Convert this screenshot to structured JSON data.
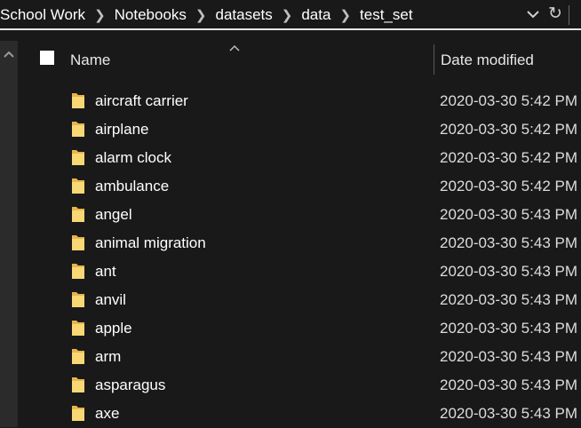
{
  "breadcrumb": [
    "School Work",
    "Notebooks",
    "datasets",
    "data",
    "test_set"
  ],
  "address_bar": {
    "dropdown_icon": "chevron-down-icon",
    "refresh_icon": "refresh-icon",
    "refresh_glyph": "↻"
  },
  "columns": {
    "name_label": "Name",
    "date_label": "Date modified",
    "sort_icon": "sort-ascending-icon"
  },
  "colors": {
    "background": "#191919",
    "text": "#ffffff",
    "folder_yellow": "#f8d775",
    "folder_shade": "#e8b54a"
  },
  "files": [
    {
      "name": "aircraft carrier",
      "date": "2020-03-30 5:42 PM",
      "icon": "folder-icon"
    },
    {
      "name": "airplane",
      "date": "2020-03-30 5:42 PM",
      "icon": "folder-icon"
    },
    {
      "name": "alarm clock",
      "date": "2020-03-30 5:42 PM",
      "icon": "folder-icon"
    },
    {
      "name": "ambulance",
      "date": "2020-03-30 5:42 PM",
      "icon": "folder-icon"
    },
    {
      "name": "angel",
      "date": "2020-03-30 5:43 PM",
      "icon": "folder-icon"
    },
    {
      "name": "animal migration",
      "date": "2020-03-30 5:43 PM",
      "icon": "folder-icon"
    },
    {
      "name": "ant",
      "date": "2020-03-30 5:43 PM",
      "icon": "folder-icon"
    },
    {
      "name": "anvil",
      "date": "2020-03-30 5:43 PM",
      "icon": "folder-icon"
    },
    {
      "name": "apple",
      "date": "2020-03-30 5:43 PM",
      "icon": "folder-icon"
    },
    {
      "name": "arm",
      "date": "2020-03-30 5:43 PM",
      "icon": "folder-icon"
    },
    {
      "name": "asparagus",
      "date": "2020-03-30 5:43 PM",
      "icon": "folder-icon"
    },
    {
      "name": "axe",
      "date": "2020-03-30 5:43 PM",
      "icon": "folder-icon"
    }
  ]
}
